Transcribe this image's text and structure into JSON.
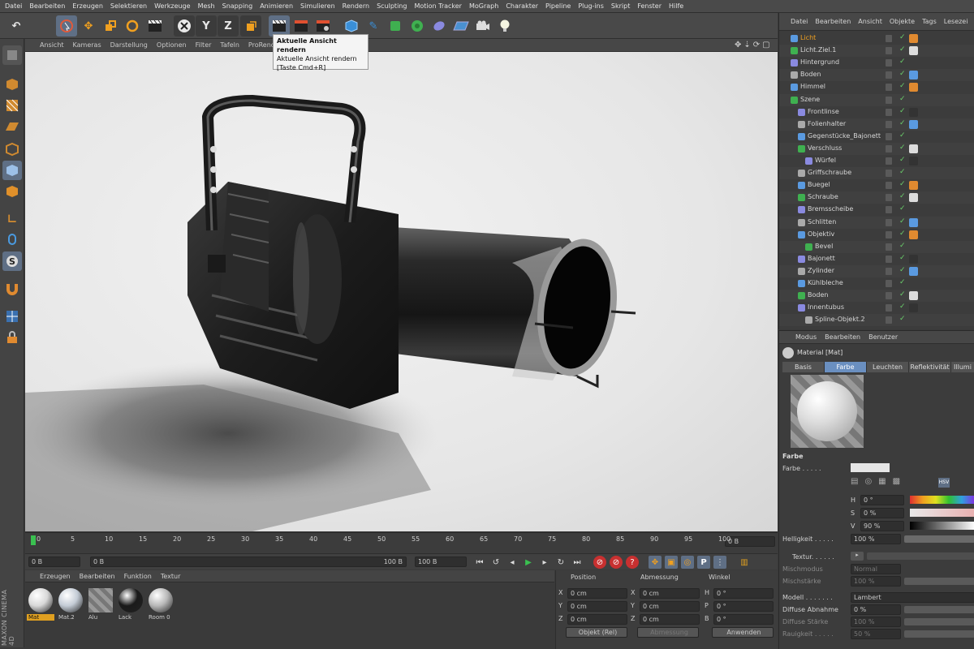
{
  "menubar": [
    "Datei",
    "Bearbeiten",
    "Erzeugen",
    "Selektieren",
    "Werkzeuge",
    "Mesh",
    "Snapping",
    "Animieren",
    "Simulieren",
    "Rendern",
    "Sculpting",
    "Motion Tracker",
    "MoGraph",
    "Charakter",
    "Pipeline",
    "Plug-ins",
    "Skript",
    "Fenster",
    "Hilfe"
  ],
  "toolbar": {
    "axis_x": "X",
    "axis_y": "Y",
    "axis_z": "Z"
  },
  "tooltip": {
    "title": "Aktuelle Ansicht rendern",
    "desc": "Aktuelle Ansicht rendern",
    "shortcut": "[Taste Cmd+R]"
  },
  "viewport_menu": [
    "Ansicht",
    "Kameras",
    "Darstellung",
    "Optionen",
    "Filter",
    "Tafeln",
    "ProRender"
  ],
  "timeline": {
    "ticks": [
      "0",
      "5",
      "10",
      "15",
      "20",
      "25",
      "30",
      "35",
      "40",
      "45",
      "50",
      "55",
      "60",
      "65",
      "70",
      "75",
      "80",
      "85",
      "90",
      "95",
      "100"
    ],
    "current_frame": "0 B"
  },
  "transport": {
    "start": "0 B",
    "range_start": "0 B",
    "range_end": "100 B",
    "end": "100 B"
  },
  "material_manager": {
    "menu": [
      "Erzeugen",
      "Bearbeiten",
      "Funktion",
      "Textur"
    ],
    "materials": [
      {
        "label": "Mat",
        "color": "#d8d8d8",
        "selected": true
      },
      {
        "label": "Mat.2",
        "color": "#c4ccd6"
      },
      {
        "label": "Alu",
        "color": "#8a8a8a"
      },
      {
        "label": "Lack",
        "color": "#1a1a1a"
      },
      {
        "label": "Room 0",
        "color": "#b8b8b8"
      }
    ],
    "logo_line1": "MAXON",
    "logo_line2": "CINEMA 4D"
  },
  "coordinates": {
    "headers": [
      "Position",
      "Abmessung",
      "Winkel"
    ],
    "rows": [
      {
        "axis": "X",
        "pos": "0 cm",
        "dim_axis": "X",
        "dim": "0 cm",
        "ang_axis": "H",
        "ang": "0 °"
      },
      {
        "axis": "Y",
        "pos": "0 cm",
        "dim_axis": "Y",
        "dim": "0 cm",
        "ang_axis": "P",
        "ang": "0 °"
      },
      {
        "axis": "Z",
        "pos": "0 cm",
        "dim_axis": "Z",
        "dim": "0 cm",
        "ang_axis": "B",
        "ang": "0 °"
      }
    ],
    "mode": "Objekt (Rel)",
    "size_mode": "Abmessung",
    "apply": "Anwenden"
  },
  "object_manager": {
    "menu": [
      "Datei",
      "Bearbeiten",
      "Ansicht",
      "Objekte",
      "Tags",
      "Lesezei"
    ],
    "objects": [
      {
        "name": "Licht",
        "indent": 0,
        "highlight": true
      },
      {
        "name": "Licht.Ziel.1",
        "indent": 0
      },
      {
        "name": "Hintergrund",
        "indent": 0
      },
      {
        "name": "Boden",
        "indent": 0
      },
      {
        "name": "Himmel",
        "indent": 0
      },
      {
        "name": "Szene",
        "indent": 0
      },
      {
        "name": "Frontlinse",
        "indent": 1
      },
      {
        "name": "Folienhalter",
        "indent": 1
      },
      {
        "name": "Gegenstücke_Bajonett",
        "indent": 1
      },
      {
        "name": "Verschluss",
        "indent": 1
      },
      {
        "name": "Würfel",
        "indent": 2
      },
      {
        "name": "Griffschraube",
        "indent": 1
      },
      {
        "name": "Buegel",
        "indent": 1
      },
      {
        "name": "Schraube",
        "indent": 1
      },
      {
        "name": "Bremsscheibe",
        "indent": 1
      },
      {
        "name": "Schlitten",
        "indent": 1
      },
      {
        "name": "Objektiv",
        "indent": 1
      },
      {
        "name": "Bevel",
        "indent": 2
      },
      {
        "name": "Bajonett",
        "indent": 1
      },
      {
        "name": "Zylinder",
        "indent": 1
      },
      {
        "name": "Kühlbleche",
        "indent": 1
      },
      {
        "name": "Boden",
        "indent": 1
      },
      {
        "name": "Innentubus",
        "indent": 1
      },
      {
        "name": "Spline-Objekt.2",
        "indent": 2
      }
    ]
  },
  "attributes": {
    "menu": [
      "Modus",
      "Bearbeiten",
      "Benutzer"
    ],
    "title": "Material [Mat]",
    "tabs": [
      "Basis",
      "Farbe",
      "Leuchten",
      "Reflektivität",
      "Illumi"
    ],
    "active_tab": "Farbe",
    "section": "Farbe",
    "farbe_label": "Farbe . . . . .",
    "color_mode": "HSV",
    "h_label": "H",
    "h_value": "0 °",
    "s_label": "S",
    "s_value": "0 %",
    "v_label": "V",
    "v_value": "90 %",
    "helligkeit_label": "Helligkeit . . . . .",
    "helligkeit_value": "100 %",
    "helligkeit_level": 1.0,
    "textur_label": "Textur. . . . . .",
    "mischmodus_label": "Mischmodus",
    "mischmodus_value": "Normal",
    "mischstaerke_label": "Mischstärke",
    "mischstaerke_value": "100 %",
    "modell_label": "Modell . . . . . . .",
    "modell_value": "Lambert",
    "diffuse_abnahme_label": "Diffuse Abnahme",
    "diffuse_abnahme_value": "0 %",
    "diffuse_staerke_label": "Diffuse Stärke",
    "diffuse_staerke_value": "100 %",
    "rauigkeit_label": "Rauigkeit . . . . .",
    "rauigkeit_value": "50 %"
  }
}
